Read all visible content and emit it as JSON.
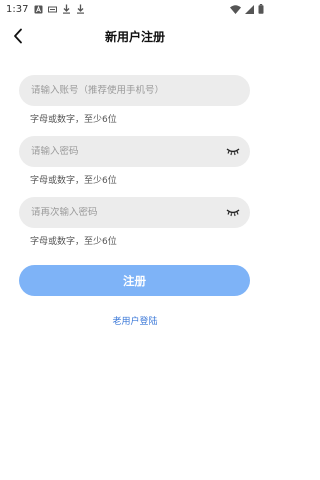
{
  "status_bar": {
    "time": "1:37",
    "left_icons": [
      "notification-a-icon",
      "notification-bar-icon",
      "download-icon",
      "download-icon"
    ],
    "right_icons": [
      "wifi-icon",
      "signal-icon",
      "battery-icon"
    ]
  },
  "header": {
    "title": "新用户注册"
  },
  "form": {
    "account_placeholder": "请输入账号（推荐使用手机号）",
    "account_hint": "字母或数字，至少6位",
    "password_placeholder": "请输入密码",
    "password_hint": "字母或数字，至少6位",
    "confirm_placeholder": "请再次输入密码",
    "confirm_hint": "字母或数字，至少6位",
    "submit_label": "注册"
  },
  "footer": {
    "old_user_link": "老用户登陆"
  },
  "colors": {
    "accent": "#7eb3f7",
    "link": "#3b78d8",
    "field_bg": "#ececec"
  }
}
